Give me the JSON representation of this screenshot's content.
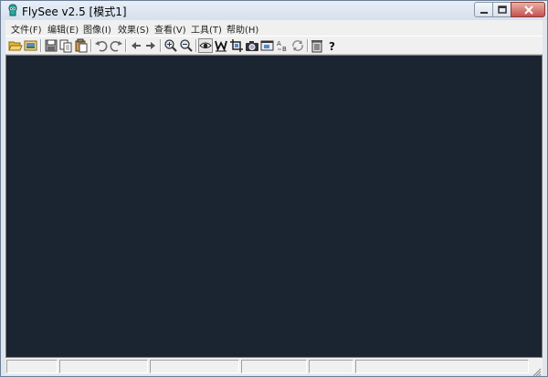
{
  "window": {
    "title": "FlySee v2.5 [模式1]"
  },
  "menu": [
    "文件(F)",
    "编辑(E)",
    "图像(I)",
    "效果(S)",
    "查看(V)",
    "工具(T)",
    "帮助(H)"
  ],
  "toolbar_icons": [
    "open-folder-icon",
    "open-image-icon",
    "save-icon",
    "copy-icon",
    "paste-icon",
    "undo-icon",
    "redo-icon",
    "previous-icon",
    "next-icon",
    "zoom-in-icon",
    "zoom-out-icon",
    "view-eye-icon",
    "watermark-icon",
    "crop-icon",
    "camera-icon",
    "screen-capture-icon",
    "rename-icon",
    "refresh-icon",
    "delete-icon",
    "help-icon"
  ],
  "statusbar": {
    "panels": [
      "",
      "",
      "",
      "",
      "",
      "",
      ""
    ]
  },
  "colors": {
    "canvas": "#1b2431",
    "chrome": "#f0f0f0",
    "titlebar": "#dae4ef",
    "close_button": "#c75050"
  }
}
